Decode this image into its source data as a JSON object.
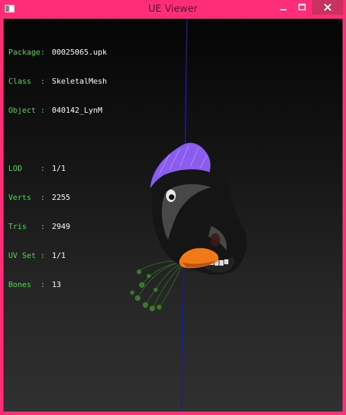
{
  "window": {
    "title": "UE Viewer",
    "colors": {
      "frame": "#ff2d78",
      "close_button": "#c9325f",
      "info_key": "#4cdc4c",
      "info_value": "#ffffff",
      "axis_line": "#1a1aa0"
    }
  },
  "controls": {
    "minimize_icon": "minimize-icon",
    "maximize_icon": "maximize-icon",
    "close_icon": "close-icon"
  },
  "info": {
    "package_key": "Package:",
    "package_value": "00025065.upk",
    "class_key": "Class  :",
    "class_value": "SkeletalMesh",
    "object_key": "Object :",
    "object_value": "040142_LynM",
    "lod_key": "LOD    :",
    "lod_value": "1/1",
    "verts_key": "Verts  :",
    "verts_value": "2255",
    "tris_key": "Tris   :",
    "tris_value": "2949",
    "uvset_key": "UV Set :",
    "uvset_value": "1/1",
    "bones_key": "Bones  :",
    "bones_value": "13"
  },
  "model": {
    "description_icon": "3d-mesh-model"
  }
}
